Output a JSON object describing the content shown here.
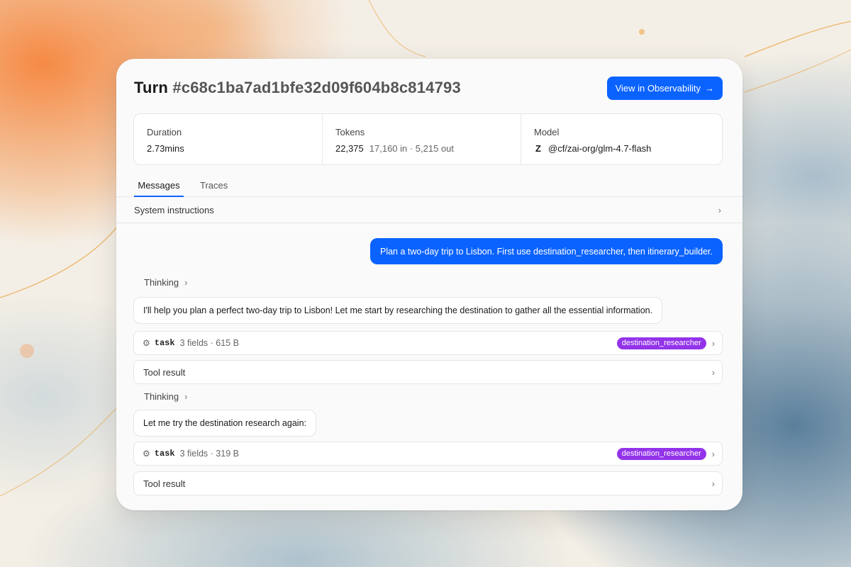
{
  "colors": {
    "accent": "#0b63ff",
    "badge": "#9333ea",
    "card_bg": "#fafafa"
  },
  "header": {
    "title_prefix": "Turn",
    "turn_id": "#c68c1ba7ad1bfe32d09f604b8c814793",
    "observability_button": "View in Observability",
    "observability_icon": "arrow-right-icon"
  },
  "stats": {
    "duration": {
      "label": "Duration",
      "value": "2.73mins"
    },
    "tokens": {
      "label": "Tokens",
      "value": "22,375",
      "detail": "17,160 in · 5,215 out"
    },
    "model": {
      "label": "Model",
      "icon": "zai-logo-icon",
      "value": "@cf/zai-org/glm-4.7-flash"
    }
  },
  "tabs": [
    {
      "label": "Messages",
      "active": true
    },
    {
      "label": "Traces",
      "active": false
    }
  ],
  "system_instructions": {
    "label": "System instructions"
  },
  "messages": {
    "user": "Plan a two-day trip to Lisbon. First use destination_researcher, then itinerary_builder.",
    "thinking_label": "Thinking",
    "assistant_1": "I'll help you plan a perfect two-day trip to Lisbon! Let me start by researching the destination to gather all the essential information.",
    "tool_call_1": {
      "name": "task",
      "meta": "3 fields · 615 B",
      "badge": "destination_researcher"
    },
    "tool_result_label": "Tool result",
    "assistant_2": "Let me try the destination research again:",
    "tool_call_2": {
      "name": "task",
      "meta": "3 fields · 319 B",
      "badge": "destination_researcher"
    }
  }
}
